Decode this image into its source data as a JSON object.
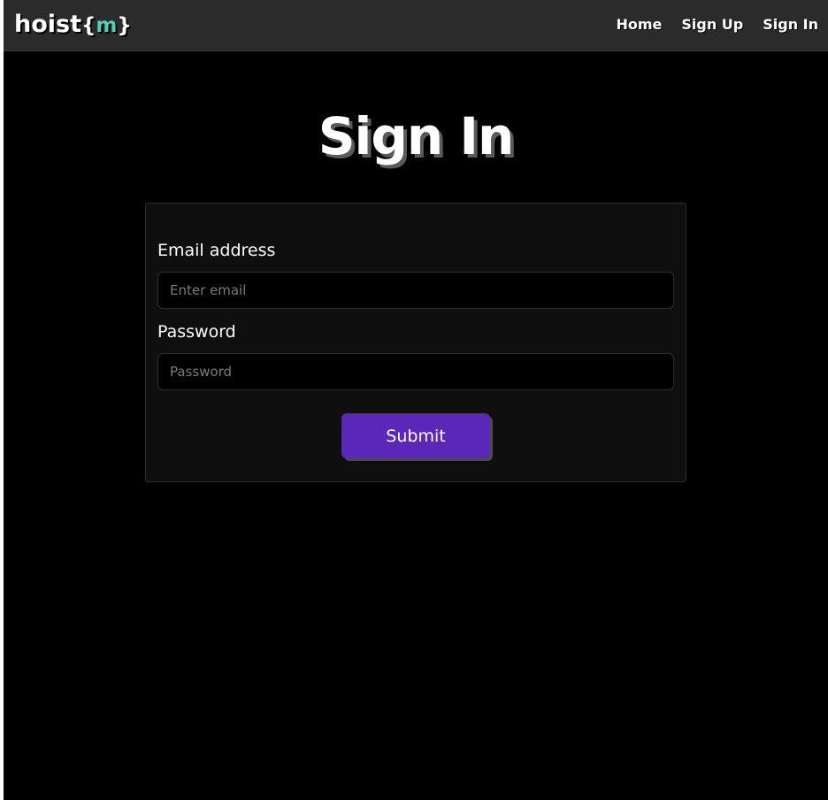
{
  "navbar": {
    "brand": {
      "prefix": "hoist",
      "open_brace": "{",
      "accent": "m",
      "close_brace": "}"
    },
    "links": [
      "Home",
      "Sign Up",
      "Sign In"
    ]
  },
  "page": {
    "title": "Sign In"
  },
  "form": {
    "email": {
      "label": "Email address",
      "placeholder": "Enter email",
      "value": ""
    },
    "password": {
      "label": "Password",
      "placeholder": "Password",
      "value": ""
    },
    "submit_label": "Submit"
  },
  "colors": {
    "background": "#000000",
    "navbar": "#2b2b2b",
    "card": "#0f0f0f",
    "brand_accent": "#4fd1b5",
    "button": "#5b27b8"
  }
}
